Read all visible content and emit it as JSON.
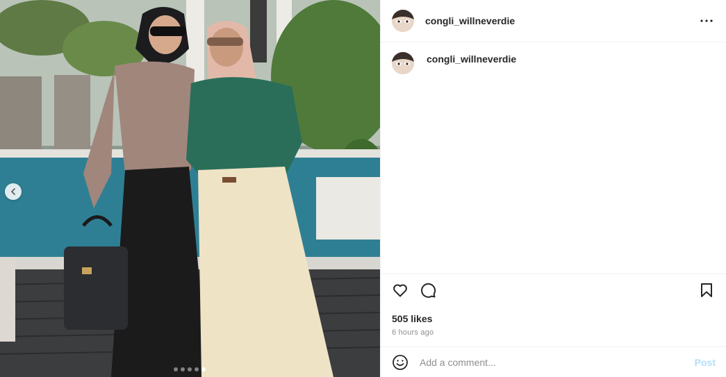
{
  "header": {
    "username": "congli_willneverdie"
  },
  "caption": {
    "username": "congli_willneverdie"
  },
  "stats": {
    "likes": "505 likes",
    "time_ago": "6 hours ago"
  },
  "comment_box": {
    "placeholder": "Add a comment...",
    "post_label": "Post"
  },
  "carousel": {
    "total_slides": 5,
    "active_slide": 5
  },
  "colors": {
    "link_disabled": "#b2dffc",
    "muted_text": "#8e8e8e",
    "primary_text": "#262626",
    "divider": "#efefef"
  },
  "icons": [
    "chevron-left-icon",
    "more-options-icon",
    "heart-icon",
    "comment-icon",
    "bookmark-icon",
    "emoji-icon"
  ]
}
